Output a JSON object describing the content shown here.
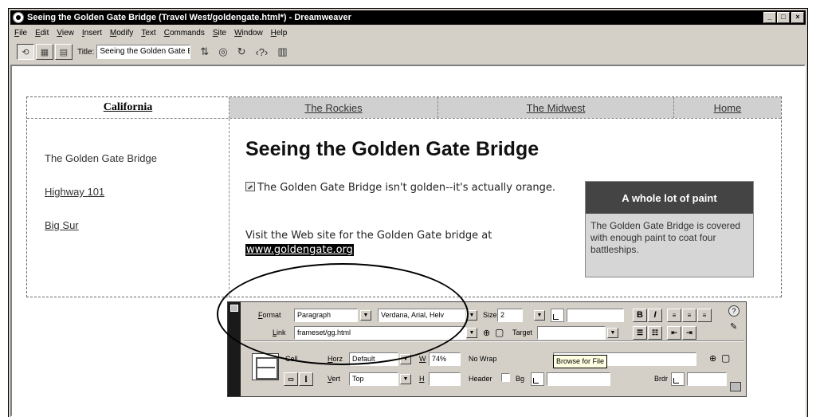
{
  "window": {
    "title": "Seeing the Golden Gate Bridge (Travel West/goldengate.html*) - Dreamweaver",
    "controls": {
      "minimize": "_",
      "maximize": "□",
      "close": "×"
    }
  },
  "menubar": {
    "items": [
      "File",
      "Edit",
      "View",
      "Insert",
      "Modify",
      "Text",
      "Commands",
      "Site",
      "Window",
      "Help"
    ]
  },
  "toolbar": {
    "title_label": "Title:",
    "title_value": "Seeing the Golden Gate Bridge"
  },
  "page": {
    "nav": [
      "California",
      "The Rockies",
      "The Midwest",
      "Home"
    ],
    "left_links": [
      "The Golden Gate Bridge",
      "Highway 101",
      "Big Sur"
    ],
    "heading": "Seeing the Golden Gate Bridge",
    "paragraph1": "The Golden Gate Bridge isn't golden--it's actually orange.",
    "paragraph2_text": "Visit the Web site for the Golden Gate bridge at",
    "paragraph2_link": "www.goldengate.org",
    "sidebar_title": "A whole lot of paint",
    "sidebar_body": "The Golden Gate Bridge is covered with enough paint to coat four battleships."
  },
  "inspector": {
    "format_label": "Format",
    "format_value": "Paragraph",
    "font_value": "Verdana, Arial, Helv",
    "size_label": "Size",
    "size_value": "2",
    "link_label": "Link",
    "link_value": "frameset/gg.html",
    "target_label": "Target",
    "bold": "B",
    "italic": "I",
    "cell_label": "Cell",
    "horz_label": "Horz",
    "horz_value": "Default",
    "vert_label": "Vert",
    "vert_value": "Top",
    "w_label": "W",
    "w_value": "74%",
    "h_label": "H",
    "nowrap_label": "No Wrap",
    "header_label": "Header",
    "bg_label": "Bg",
    "brdr_label": "Brdr",
    "tooltip": "Browse for File"
  }
}
